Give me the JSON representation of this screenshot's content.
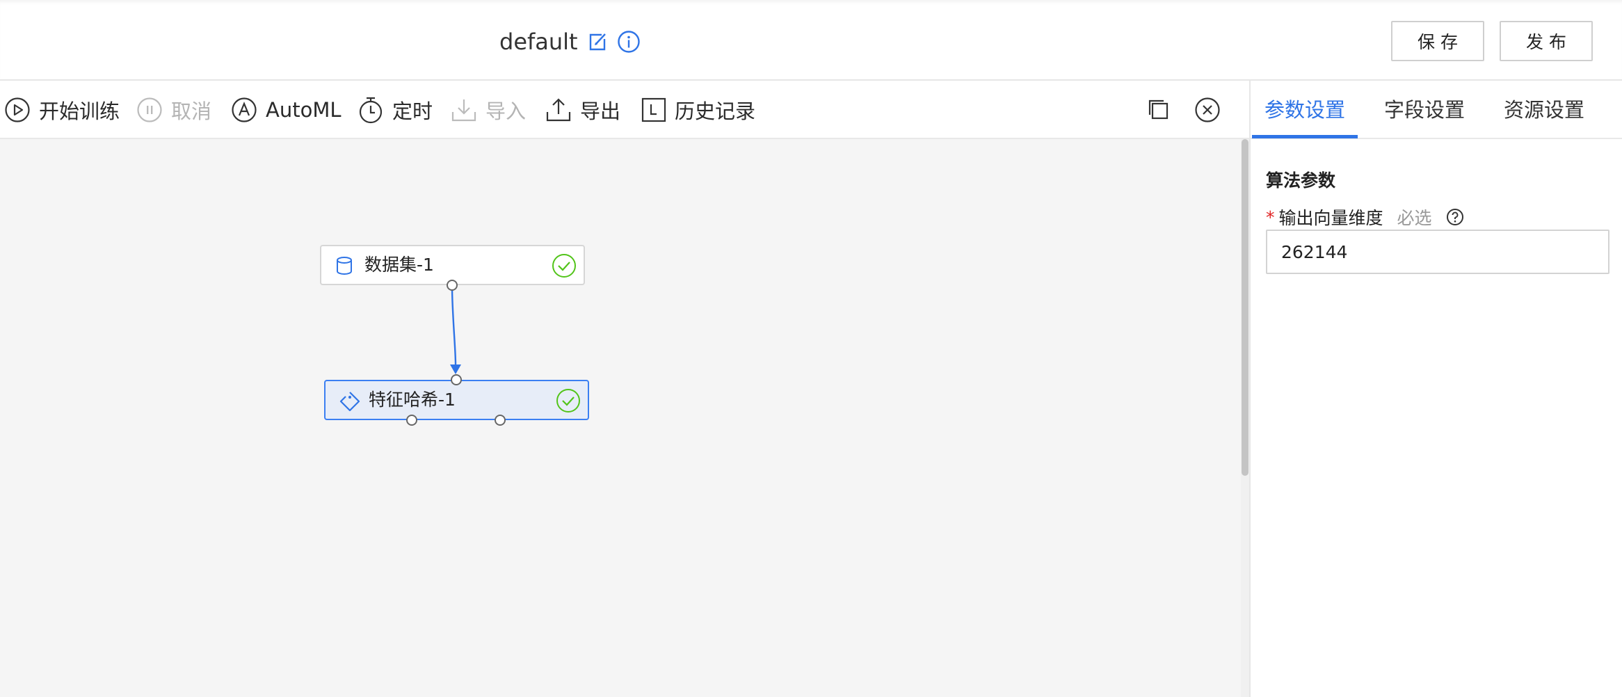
{
  "header": {
    "title": "default",
    "icons": {
      "edit": "edit-icon",
      "info": "info-icon"
    },
    "buttons": {
      "save": "保存",
      "publish": "发布"
    }
  },
  "toolbar": {
    "start_training": "开始训练",
    "cancel": "取消",
    "automl": "AutoML",
    "schedule": "定时",
    "import": "导入",
    "export": "导出",
    "history": "历史记录",
    "icons": [
      "play-icon",
      "pause-icon",
      "automl-icon",
      "timer-icon",
      "download-icon",
      "upload-icon",
      "history-icon",
      "copy-icon",
      "close-circle-icon"
    ]
  },
  "canvas": {
    "nodes": [
      {
        "label": "数据集-1",
        "icon": "database-icon",
        "status": "success"
      },
      {
        "label": "特征哈希-1",
        "icon": "tag-icon",
        "status": "success",
        "selected": true
      }
    ]
  },
  "panel": {
    "tabs": [
      "参数设置",
      "字段设置",
      "资源设置"
    ],
    "active_tab": 0,
    "section_title": "算法参数",
    "field": {
      "required_mark": "*",
      "label": "输出向量维度",
      "hint": "必选",
      "value": "262144"
    }
  },
  "colors": {
    "accent": "#2f74e6",
    "node_selected_bg": "#e7edf8",
    "success": "#52c41a",
    "canvas_bg": "#f5f5f5",
    "required": "#e02424"
  }
}
